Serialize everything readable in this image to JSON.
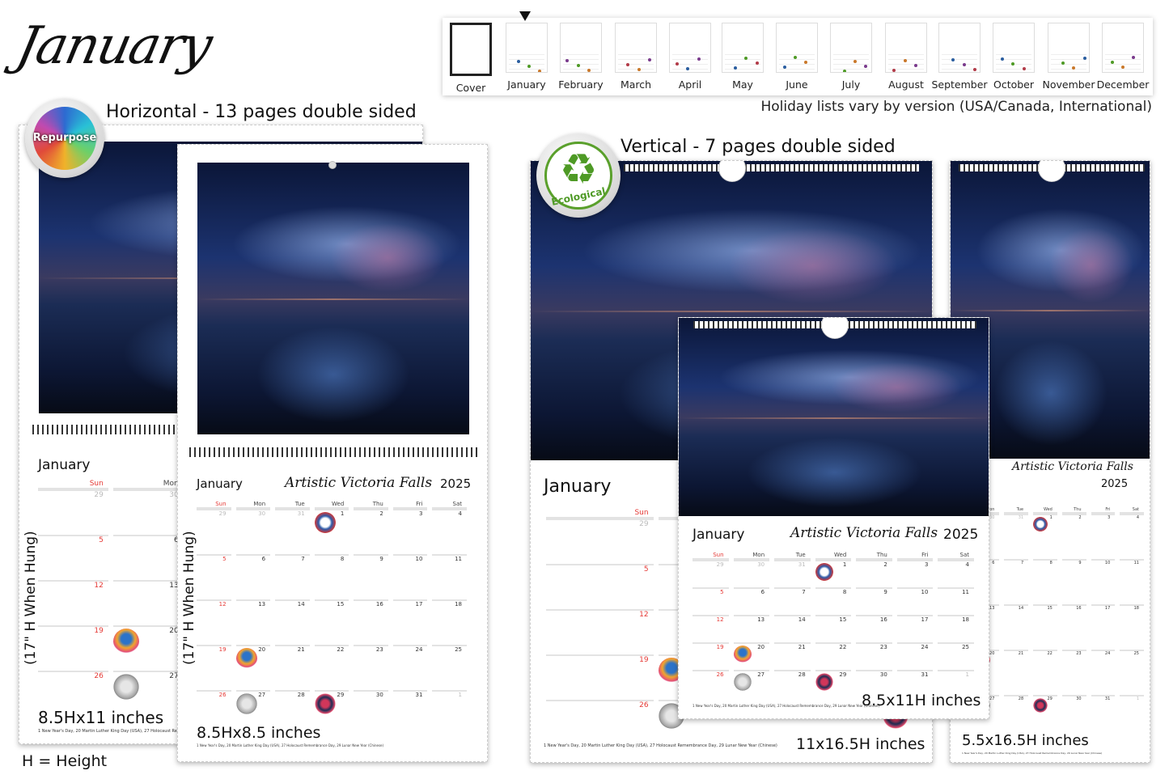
{
  "title": "January",
  "strip": {
    "months": [
      "Cover",
      "January",
      "February",
      "March",
      "April",
      "May",
      "June",
      "July",
      "August",
      "September",
      "October",
      "November",
      "December"
    ],
    "selected": "January",
    "holiday_note": "Holiday lists vary by version (USA/Canada, International)"
  },
  "horizontal": {
    "heading": "Horizontal - 13 pages double sided",
    "badge_label": "Repurpose",
    "rotated_note": "(17\" H When Hung)",
    "size_large": "8.5Hx11 inches",
    "size_small": "8.5Hx8.5 inches"
  },
  "vertical": {
    "heading": "Vertical - 7 pages double sided",
    "badge_label": "Ecological",
    "size_large": "11x16.5H inches",
    "size_medium": "8.5x11H inches",
    "size_small": "5.5x16.5H inches"
  },
  "calendar": {
    "month": "January",
    "title": "Artistic Victoria Falls",
    "year": "2025",
    "weekdays": [
      "Sun",
      "Mon",
      "Tue",
      "Wed",
      "Thu",
      "Fri",
      "Sat"
    ],
    "weeks": [
      [
        "29",
        "30",
        "31",
        "1",
        "2",
        "3",
        "4"
      ],
      [
        "5",
        "6",
        "7",
        "8",
        "9",
        "10",
        "11"
      ],
      [
        "12",
        "13",
        "14",
        "15",
        "16",
        "17",
        "18"
      ],
      [
        "19",
        "20",
        "21",
        "22",
        "23",
        "24",
        "25"
      ],
      [
        "26",
        "27",
        "28",
        "29",
        "30",
        "31",
        "1"
      ]
    ],
    "footnote": "1 New Year's Day, 20 Martin Luther King Day (USA), 27 Holocaust Remembrance Day, 29 Lunar New Year (Chinese)"
  },
  "height_note": "H = Height"
}
